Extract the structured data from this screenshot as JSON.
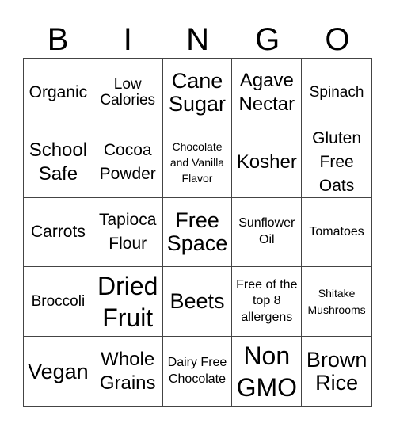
{
  "header": {
    "letters": [
      "B",
      "I",
      "N",
      "G",
      "O"
    ]
  },
  "cells": [
    "Organic",
    "Low Calories",
    "Cane Sugar",
    "Agave Nectar",
    "Spinach",
    "School Safe",
    "Cocoa Powder",
    "Chocolate and Vanilla Flavor",
    "Kosher",
    "Gluten Free Oats",
    "Carrots",
    "Tapioca Flour",
    "Free Space",
    "Sunflower Oil",
    "Tomatoes",
    "Broccoli",
    "Dried Fruit",
    "Beets",
    "Free of the top 8 allergens",
    "Shitake Mushrooms",
    "Vegan",
    "Whole Grains",
    "Dairy Free Chocolate",
    "Non GMO",
    "Brown Rice"
  ]
}
